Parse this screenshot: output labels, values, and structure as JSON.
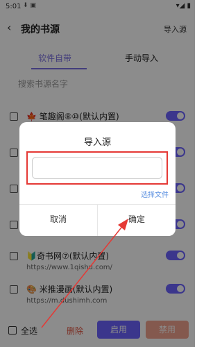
{
  "status": {
    "time": "5:01",
    "icons": "⬇ ▣",
    "right_icons": "▾◢ ▮"
  },
  "header": {
    "back_icon": "‹",
    "title": "我的书源",
    "import_link": "导入源"
  },
  "tabs": [
    {
      "label": "软件自带"
    },
    {
      "label": "手动导入"
    }
  ],
  "search": {
    "placeholder": "搜索书源名字"
  },
  "sources": [
    {
      "name": "🍁 笔趣阁⑧⑩(默认内置)",
      "url": ""
    },
    {
      "name": "",
      "url": ""
    },
    {
      "name": "",
      "url": ""
    },
    {
      "name": "",
      "url": ""
    },
    {
      "name": "🔰奇书网⑦(默认内置)",
      "url": "https://www.1qishu.com/"
    },
    {
      "name": "🎨 米推漫画(默认内置)",
      "url": "https://m.dushimh.com"
    }
  ],
  "bottom": {
    "select_all": "全选",
    "delete": "删除",
    "enable": "启用",
    "disable": "禁用"
  },
  "dialog": {
    "title": "导入源",
    "input_value": "",
    "select_file": "选择文件",
    "cancel": "取消",
    "confirm": "确定"
  },
  "colors": {
    "accent": "#6c63ff",
    "highlight": "#e53935",
    "delete": "#e0523f"
  }
}
